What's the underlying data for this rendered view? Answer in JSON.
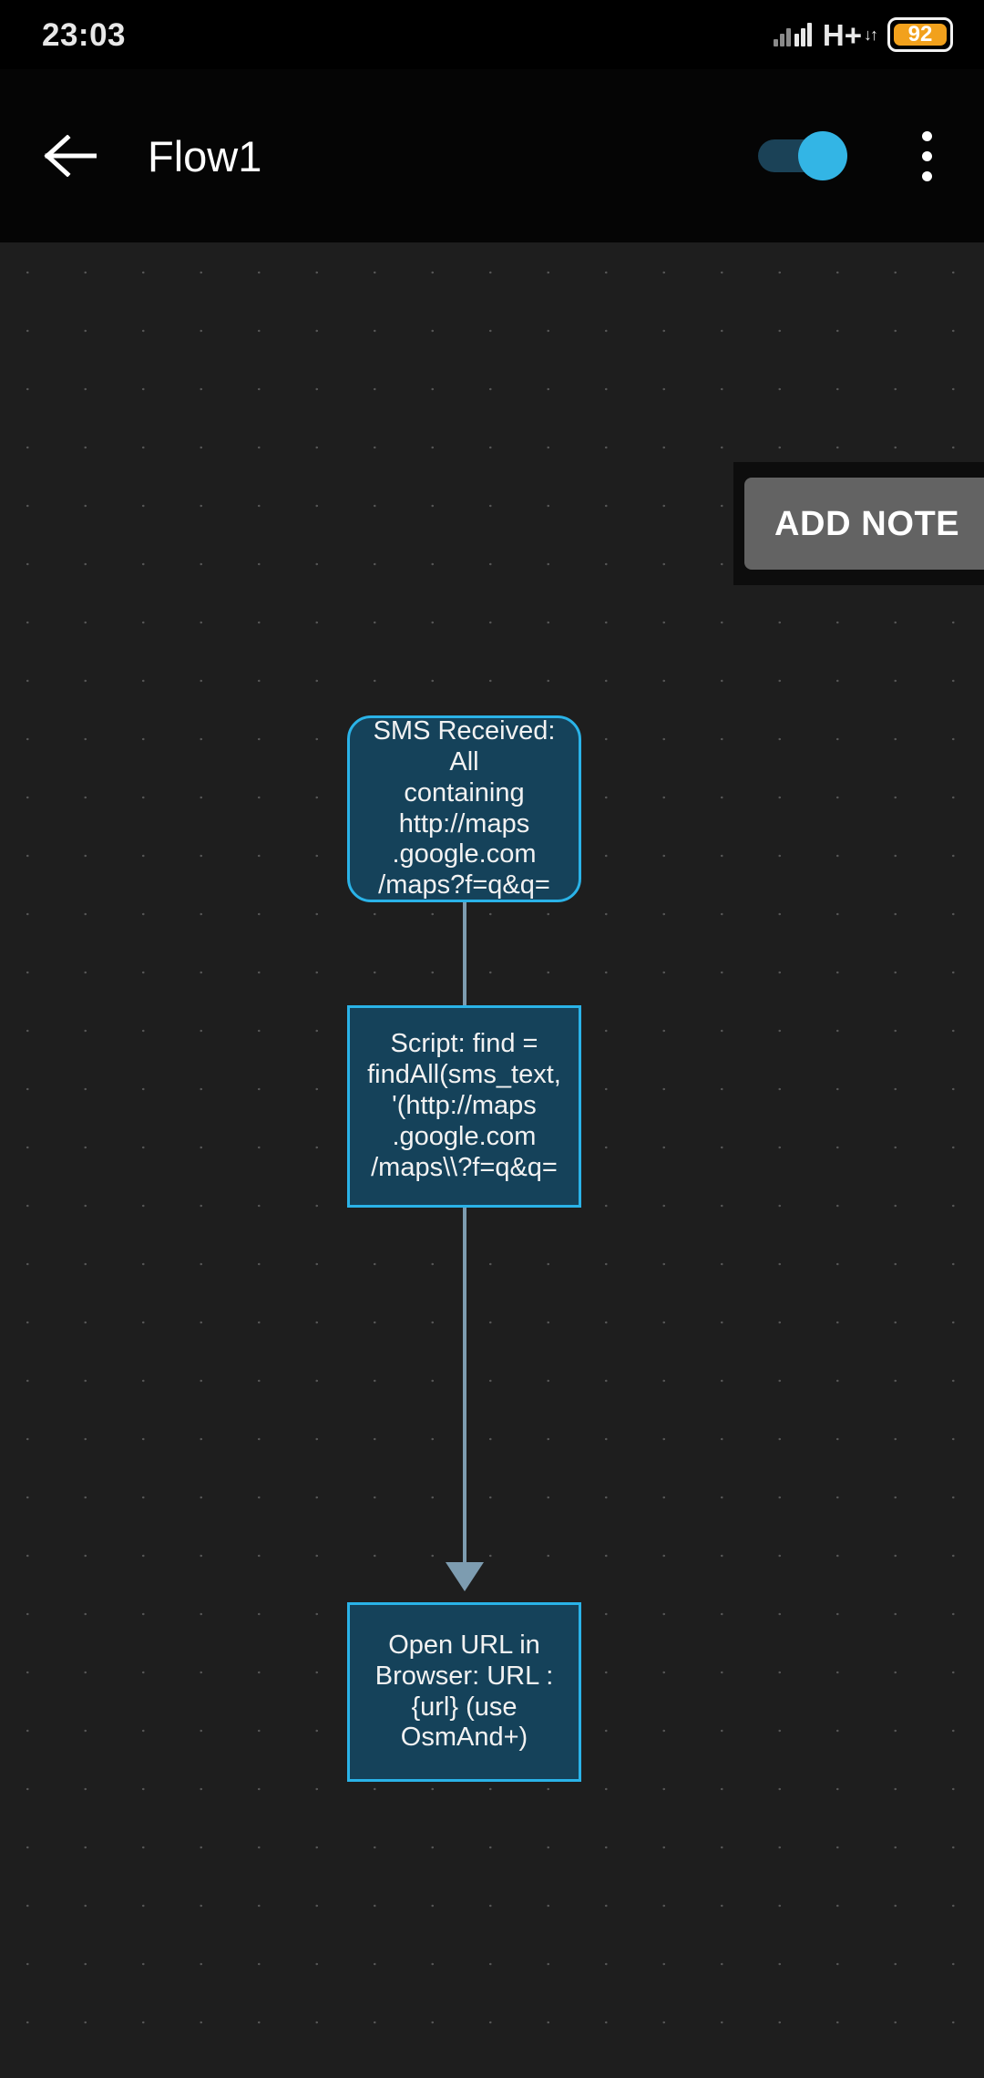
{
  "status_bar": {
    "clock": "23:03",
    "network_type": "H+",
    "network_arrows": "↓↑",
    "battery_level": "92",
    "signal_icon": "signal-bars-icon",
    "battery_icon": "battery-icon",
    "battery_color": "#f2a11c"
  },
  "app_bar": {
    "back_icon": "back-arrow-icon",
    "title": "Flow1",
    "toggle": {
      "name": "flow-enabled-toggle",
      "state": "on",
      "accent_color": "#33b5e5"
    },
    "overflow_icon": "overflow-menu-icon"
  },
  "canvas": {
    "background_color": "#1e1e1e",
    "grid_dot_color": "#565656",
    "node_fill": "#15425a",
    "node_border": "#2ab3e8",
    "connector_color": "#7d9cb0",
    "nodes": [
      {
        "id": "sms-received",
        "shape": "rounded",
        "label": "SMS Received: All\ncontaining\nhttp://maps\n.google.com\n/maps?f=q&q="
      },
      {
        "id": "script",
        "shape": "rect",
        "label": "Script: find =\nfindAll(sms_text,\n'(http://maps\n.google.com\n/maps\\\\?f=q&q="
      },
      {
        "id": "open-url-in-browser",
        "shape": "rect",
        "label": "Open URL in\nBrowser: URL :\n{url} (use\nOsmAnd+)"
      }
    ]
  },
  "add_note": {
    "label": "ADD NOTE",
    "background": "#636363"
  }
}
